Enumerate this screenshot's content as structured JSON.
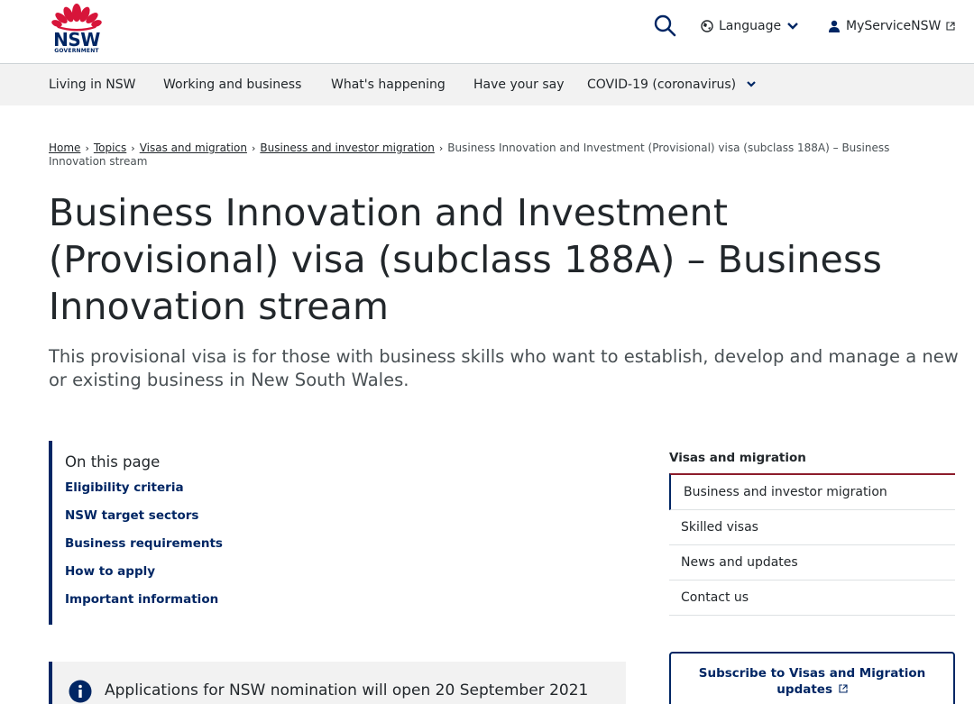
{
  "header": {
    "logo_text": "NSW",
    "logo_subtext": "GOVERNMENT",
    "search_icon": "search-icon",
    "language_label": "Language",
    "account_label": "MyServiceNSW"
  },
  "nav": {
    "items": [
      {
        "label": "Living in NSW"
      },
      {
        "label": "Working and business"
      },
      {
        "label": "What's happening"
      },
      {
        "label": "Have your say"
      },
      {
        "label": "COVID-19 (coronavirus)"
      }
    ]
  },
  "breadcrumb": {
    "items": [
      "Home",
      "Topics",
      "Visas and migration",
      "Business and investor migration"
    ],
    "current": "Business Innovation and Investment (Provisional) visa (subclass 188A) – Business Innovation stream"
  },
  "page": {
    "title": "Business Innovation and Investment (Provisional) visa (subclass 188A) – Business Innovation stream",
    "intro": "This provisional visa is for those with business skills who want to establish, develop and manage a new or existing business in New South Wales."
  },
  "on_this_page": {
    "heading": "On this page",
    "links": [
      "Eligibility criteria",
      "NSW target sectors",
      "Business requirements",
      "How to apply",
      "Important information"
    ]
  },
  "notice": {
    "text": "Applications for NSW nomination will open 20 September 2021"
  },
  "side_nav": {
    "heading": "Visas and migration",
    "items": [
      "Business and investor migration",
      "Skilled visas",
      "News and updates",
      "Contact us"
    ]
  },
  "subscribe": {
    "line1": "Subscribe to Visas and Migration",
    "line2": "updates"
  },
  "colors": {
    "brand_navy": "#002664",
    "brand_red": "#d7153a",
    "accent_border": "#8c1c2b"
  }
}
